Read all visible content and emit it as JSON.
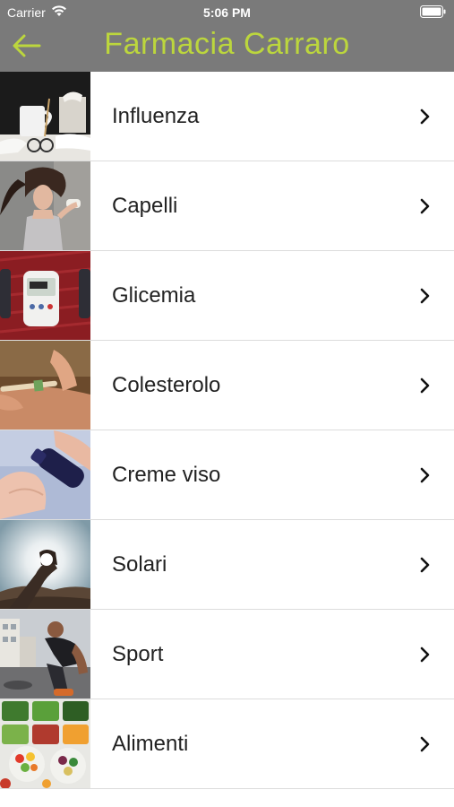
{
  "status": {
    "carrier": "Carrier",
    "time": "5:06 PM"
  },
  "nav": {
    "title": "Farmacia Carraro",
    "back_icon": "arrow-left-icon"
  },
  "colors": {
    "topbar": "#7a7a7a",
    "title": "#bcd63d",
    "separator": "#dcdcdc"
  },
  "items": [
    {
      "label": "Influenza",
      "image": "flu-photo"
    },
    {
      "label": "Capelli",
      "image": "hair-photo"
    },
    {
      "label": "Glicemia",
      "image": "glucose-meter-photo"
    },
    {
      "label": "Colesterolo",
      "image": "cholesterol-test-photo"
    },
    {
      "label": "Creme viso",
      "image": "face-cream-photo"
    },
    {
      "label": "Solari",
      "image": "sun-photo"
    },
    {
      "label": "Sport",
      "image": "sport-photo"
    },
    {
      "label": "Alimenti",
      "image": "food-photo"
    }
  ]
}
